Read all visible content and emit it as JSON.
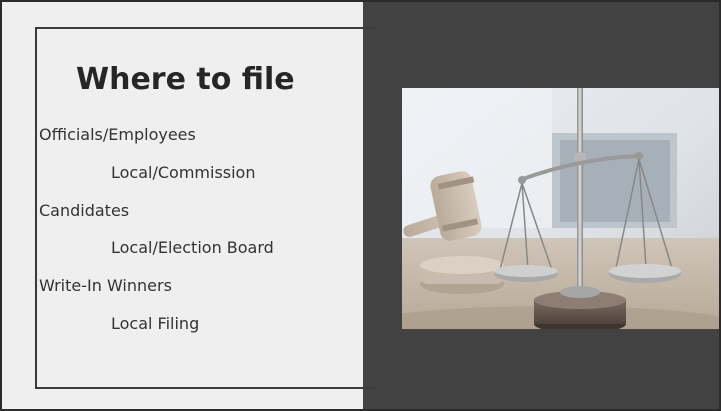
{
  "slide": {
    "title": "Where to file",
    "items": [
      {
        "label": "Officials/Employees",
        "level": 1
      },
      {
        "label": "Local/Commission",
        "level": 2
      },
      {
        "label": "Candidates",
        "level": 1
      },
      {
        "label": "Local/Election Board",
        "level": 2
      },
      {
        "label": "Write-In Winners",
        "level": 1
      },
      {
        "label": "Local Filing",
        "level": 2
      }
    ]
  },
  "image": {
    "subject": "scales-of-justice-and-gavel",
    "colors": {
      "panel_dark": "#424242",
      "panel_light": "#efefef"
    }
  }
}
